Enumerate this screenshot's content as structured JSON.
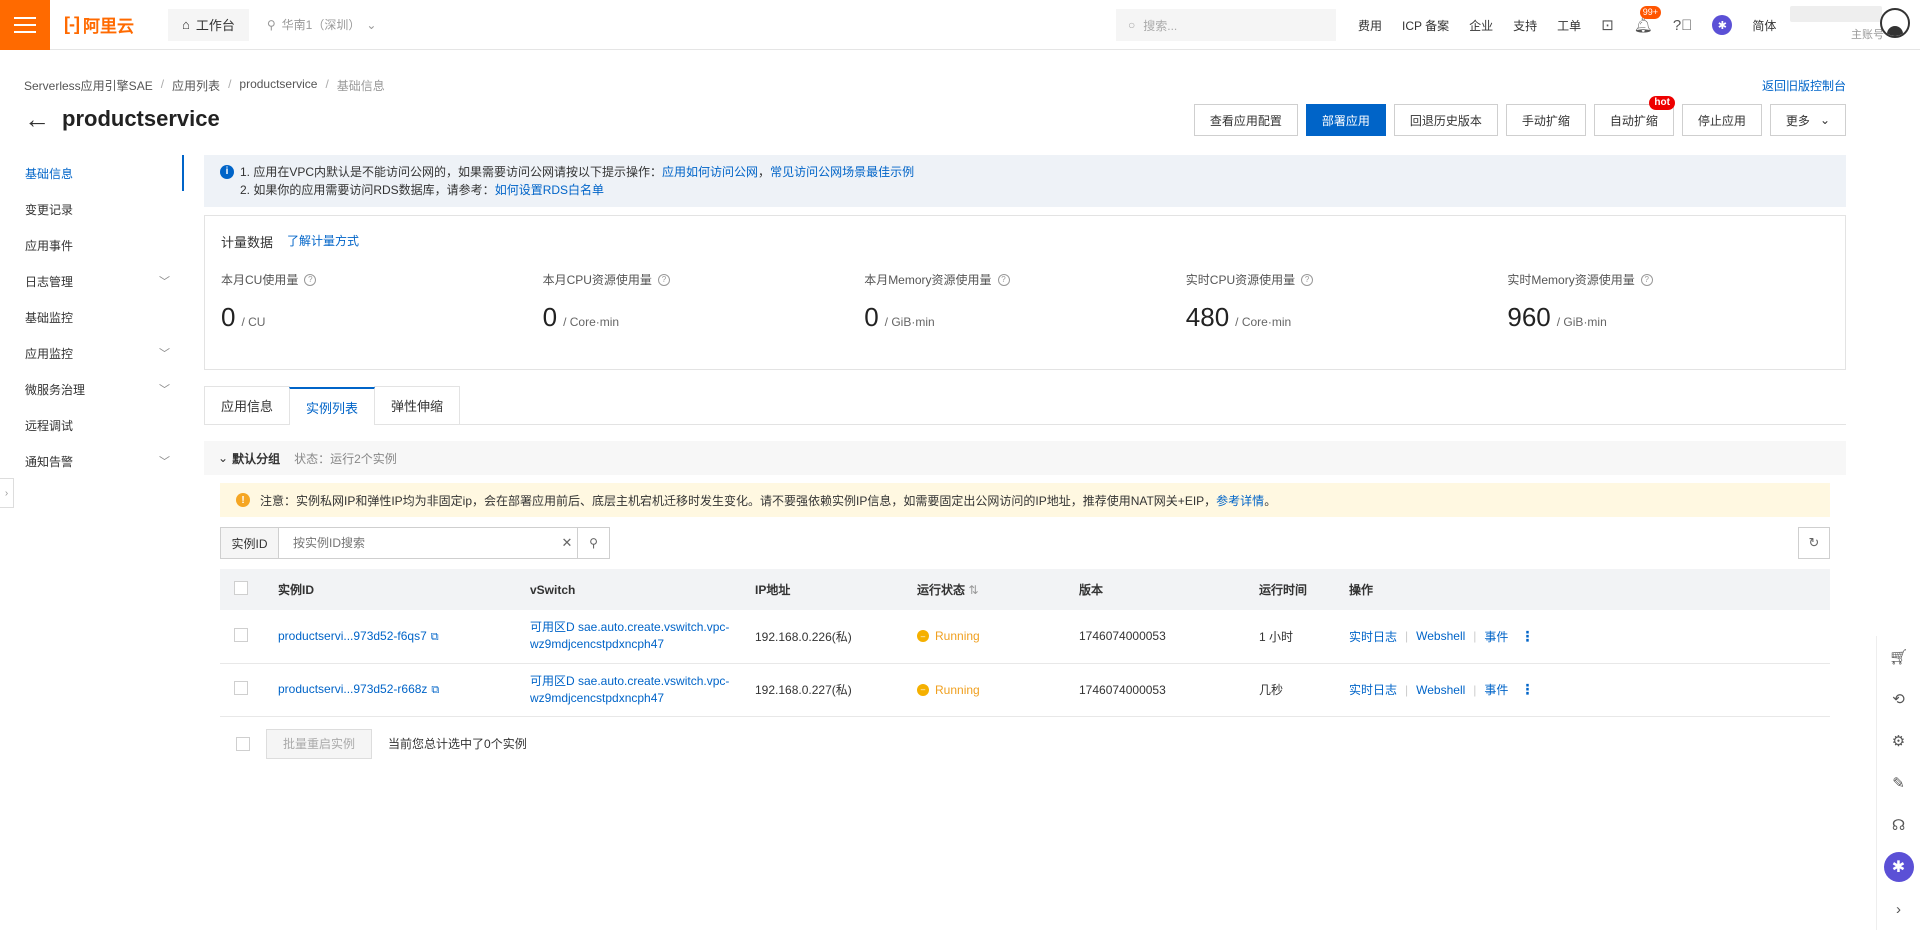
{
  "topbar": {
    "logo_text": "阿里云",
    "logo_mark": "[-]",
    "workbench": "工作台",
    "region": "华南1（深圳）",
    "search_placeholder": "搜索...",
    "nav": [
      "费用",
      "ICP 备案",
      "企业",
      "支持",
      "工单"
    ],
    "notif_badge": "99+",
    "lang": "简体",
    "account_sub": "主账号"
  },
  "breadcrumb": [
    "Serverless应用引擎SAE",
    "应用列表",
    "productservice",
    "基础信息"
  ],
  "old_console_link": "返回旧版控制台",
  "page_title": "productservice",
  "actions": {
    "view_config": "查看应用配置",
    "deploy": "部署应用",
    "rollback": "回退历史版本",
    "manual_scale": "手动扩缩",
    "auto_scale": "自动扩缩",
    "hot": "hot",
    "stop": "停止应用",
    "more": "更多"
  },
  "sidenav": [
    {
      "label": "基础信息",
      "active": true,
      "expandable": false
    },
    {
      "label": "变更记录",
      "expandable": false
    },
    {
      "label": "应用事件",
      "expandable": false
    },
    {
      "label": "日志管理",
      "expandable": true
    },
    {
      "label": "基础监控",
      "expandable": false
    },
    {
      "label": "应用监控",
      "expandable": true
    },
    {
      "label": "微服务治理",
      "expandable": true
    },
    {
      "label": "远程调试",
      "expandable": false
    },
    {
      "label": "通知告警",
      "expandable": true
    }
  ],
  "notice": {
    "line1_prefix": "1. 应用在VPC内默认是不能访问公网的，如果需要访问公网请按以下提示操作：",
    "line1_link1": "应用如何访问公网",
    "line1_sep": "，",
    "line1_link2": "常见访问公网场景最佳示例",
    "line2_prefix": "2. 如果你的应用需要访问RDS数据库，请参考：",
    "line2_link": "如何设置RDS白名单"
  },
  "metrics": {
    "title": "计量数据",
    "link": "了解计量方式",
    "items": [
      {
        "label": "本月CU使用量",
        "value": "0",
        "unit": "/ CU"
      },
      {
        "label": "本月CPU资源使用量",
        "value": "0",
        "unit": "/ Core·min"
      },
      {
        "label": "本月Memory资源使用量",
        "value": "0",
        "unit": "/ GiB·min"
      },
      {
        "label": "实时CPU资源使用量",
        "value": "480",
        "unit": "/ Core·min"
      },
      {
        "label": "实时Memory资源使用量",
        "value": "960",
        "unit": "/ GiB·min"
      }
    ]
  },
  "tabs": [
    "应用信息",
    "实例列表",
    "弹性伸缩"
  ],
  "group": {
    "name": "默认分组",
    "status": "状态：运行2个实例"
  },
  "warning": {
    "text": "注意：实例私网IP和弹性IP均为非固定ip，会在部署应用前后、底层主机宕机迁移时发生变化。请不要强依赖实例IP信息，如需要固定出公网访问的IP地址，推荐使用NAT网关+EIP，",
    "link": "参考详情",
    "tail": "。"
  },
  "filter": {
    "type": "实例ID",
    "placeholder": "按实例ID搜索"
  },
  "table": {
    "headers": [
      "实例ID",
      "vSwitch",
      "IP地址",
      "运行状态",
      "版本",
      "运行时间",
      "操作"
    ],
    "rows": [
      {
        "id": "productservi...973d52-f6qs7",
        "vswitch_1": "可用区D sae.auto.create.vswitch.vpc-",
        "vswitch_2": "wz9mdjcencstpdxncph47",
        "ip": "192.168.0.226(私)",
        "status": "Running",
        "version": "1746074000053",
        "uptime": "1 小时",
        "op1": "实时日志",
        "op2": "Webshell",
        "op3": "事件"
      },
      {
        "id": "productservi...973d52-r668z",
        "vswitch_1": "可用区D sae.auto.create.vswitch.vpc-",
        "vswitch_2": "wz9mdjcencstpdxncph47",
        "ip": "192.168.0.227(私)",
        "status": "Running",
        "version": "1746074000053",
        "uptime": "几秒",
        "op1": "实时日志",
        "op2": "Webshell",
        "op3": "事件"
      }
    ]
  },
  "footer": {
    "batch_restart": "批量重启实例",
    "selected": "当前您总计选中了0个实例"
  },
  "colors": {
    "accent": "#0064c8",
    "brand": "#ff6a00",
    "running": "#f0a020"
  }
}
